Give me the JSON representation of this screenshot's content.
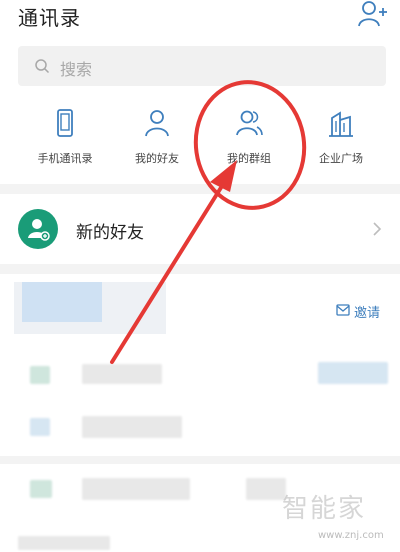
{
  "header": {
    "title": "通讯录"
  },
  "search": {
    "placeholder": "搜索"
  },
  "quick_actions": [
    {
      "label": "手机通讯录",
      "icon": "phone-icon"
    },
    {
      "label": "我的好友",
      "icon": "person-icon"
    },
    {
      "label": "我的群组",
      "icon": "group-icon"
    },
    {
      "label": "企业广场",
      "icon": "building-icon"
    }
  ],
  "new_friends": {
    "label": "新的好友"
  },
  "group": {
    "invite_label": "邀请"
  },
  "watermark": {
    "text": "智能家",
    "url": "www.znj.com"
  },
  "colors": {
    "accent": "#3f7fbd",
    "green": "#1a9c78",
    "annotation": "#e53935"
  }
}
